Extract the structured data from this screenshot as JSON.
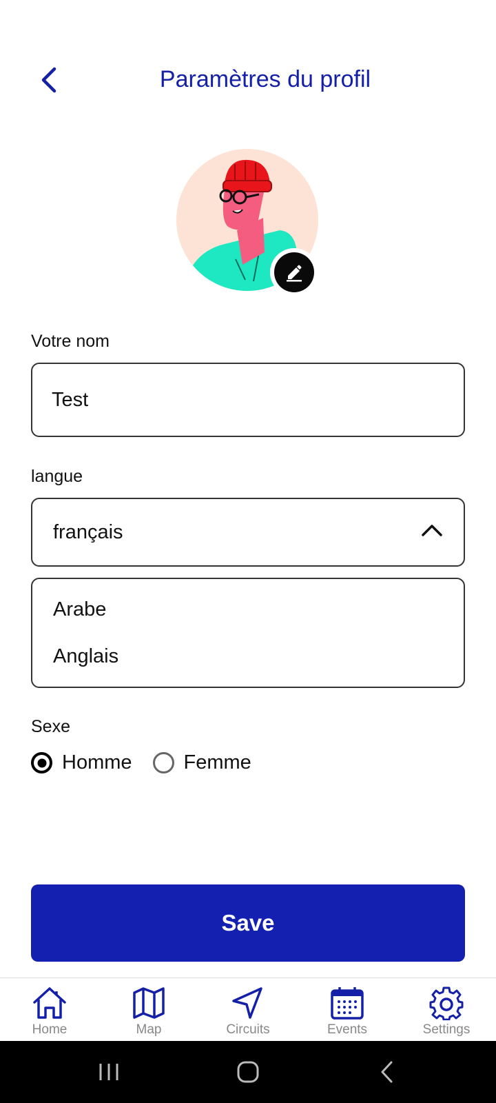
{
  "header": {
    "title": "Paramètres du profil"
  },
  "colors": {
    "primary": "#1420b0",
    "title": "#1420a8",
    "avatar_bg": "#fde3d6"
  },
  "form": {
    "name_label": "Votre nom",
    "name_value": "Test",
    "language_label": "langue",
    "language_selected": "français",
    "language_options": [
      "Arabe",
      "Anglais"
    ],
    "gender_label": "Sexe",
    "gender_options": [
      {
        "label": "Homme",
        "checked": true
      },
      {
        "label": "Femme",
        "checked": false
      }
    ]
  },
  "save_label": "Save",
  "bottom_nav": [
    {
      "label": "Home",
      "icon": "home-icon"
    },
    {
      "label": "Map",
      "icon": "map-icon"
    },
    {
      "label": "Circuits",
      "icon": "navigation-arrow-icon"
    },
    {
      "label": "Events",
      "icon": "calendar-icon"
    },
    {
      "label": "Settings",
      "icon": "gear-icon"
    }
  ]
}
